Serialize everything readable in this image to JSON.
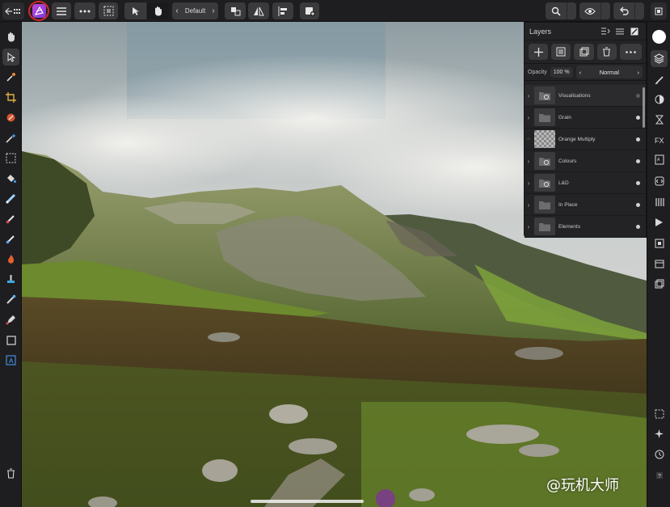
{
  "toolbar": {
    "style_label": "Default",
    "personas": [
      "brand-persona"
    ],
    "buttons": [
      "back-grid",
      "brand",
      "menu",
      "more",
      "select-area",
      "move-tool-mode",
      "hand-mode",
      "style-prev",
      "style-next",
      "arrange",
      "flip",
      "align",
      "add-layer",
      "zoom",
      "view",
      "undo",
      "fullscreen"
    ]
  },
  "layers_panel": {
    "title": "Layers",
    "opacity_label": "Opacity",
    "opacity_value": "100 %",
    "blend_mode": "Normal",
    "layers": [
      {
        "name": "Visualisations",
        "type": "group",
        "visible": false
      },
      {
        "name": "Grain",
        "type": "folder",
        "visible": true
      },
      {
        "name": "Orange Multiply",
        "type": "pixel",
        "visible": true
      },
      {
        "name": "Colours",
        "type": "group",
        "visible": true
      },
      {
        "name": "L&D",
        "type": "group",
        "visible": true
      },
      {
        "name": "In Place",
        "type": "folder",
        "visible": true
      },
      {
        "name": "Elements",
        "type": "folder",
        "visible": true
      }
    ]
  },
  "left_tools": [
    "hand-icon",
    "pointer-icon",
    "eyedropper-icon",
    "crop-icon",
    "brush-select-icon",
    "magic-wand-icon",
    "marquee-icon",
    "fill-icon",
    "gradient-icon",
    "paint-brush-icon",
    "erase-brush-icon",
    "burn-icon",
    "clone-icon",
    "heal-icon",
    "pen-icon",
    "shape-icon",
    "text-icon",
    "trash-icon"
  ],
  "right_tools": [
    "color-icon",
    "layers-icon",
    "brushes-icon",
    "adjustments-icon",
    "history-icon",
    "fx-icon",
    "channels-icon",
    "scripts-icon",
    "stock-icon",
    "navigator-icon",
    "transform-icon",
    "library-icon",
    "snapshots-icon",
    "settings-icon",
    "grid-icon",
    "compass-icon",
    "clock-icon",
    "help-icon"
  ],
  "watermark": "@玩机大师",
  "colors": {
    "accent": "#c04ad8",
    "highlight_circle": "#d6262a",
    "panel_bg": "#232325",
    "toolbar_bg": "#1e1e20"
  }
}
